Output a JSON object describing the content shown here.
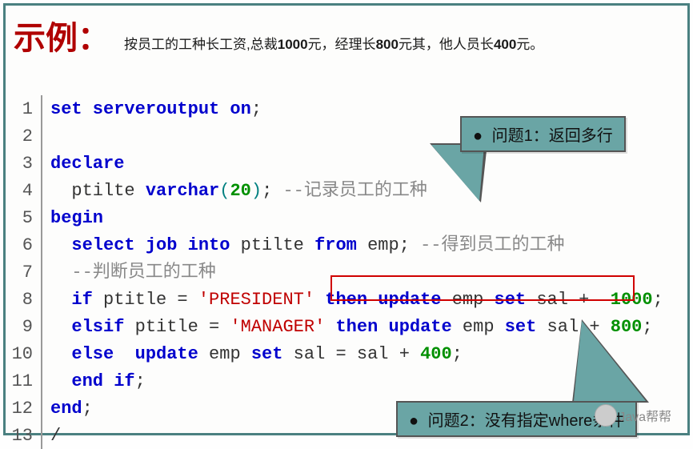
{
  "title": {
    "main": "示例",
    "colon": "：",
    "desc_prefix": "按员工的工种长工资,总裁",
    "n1": "1000",
    "desc_mid1": "元，经理长",
    "n2": "800",
    "desc_mid2": "元其，他人员长",
    "n3": "400",
    "desc_suffix": "元。"
  },
  "code": {
    "lines": [
      {
        "n": "1",
        "segs": [
          {
            "t": "set serveroutput on",
            "c": "kw"
          },
          {
            "t": ";",
            "c": ""
          }
        ]
      },
      {
        "n": "2",
        "segs": []
      },
      {
        "n": "3",
        "segs": [
          {
            "t": "declare",
            "c": "kw"
          }
        ]
      },
      {
        "n": "4",
        "segs": [
          {
            "t": "  ptilte ",
            "c": ""
          },
          {
            "t": "varchar",
            "c": "kw"
          },
          {
            "t": "(",
            "c": "paren"
          },
          {
            "t": "20",
            "c": "num"
          },
          {
            "t": ")",
            "c": "paren"
          },
          {
            "t": "; ",
            "c": ""
          },
          {
            "t": "--记录员工的工种",
            "c": "cmt"
          }
        ]
      },
      {
        "n": "5",
        "segs": [
          {
            "t": "begin",
            "c": "kw"
          }
        ]
      },
      {
        "n": "6",
        "segs": [
          {
            "t": "  ",
            "c": ""
          },
          {
            "t": "select job into",
            "c": "kw"
          },
          {
            "t": " ptilte ",
            "c": ""
          },
          {
            "t": "from",
            "c": "kw"
          },
          {
            "t": " emp; ",
            "c": ""
          },
          {
            "t": "--得到员工的工种",
            "c": "cmt"
          }
        ]
      },
      {
        "n": "7",
        "segs": [
          {
            "t": "  ",
            "c": ""
          },
          {
            "t": "--判断员工的工种",
            "c": "cmt"
          }
        ]
      },
      {
        "n": "8",
        "segs": [
          {
            "t": "  ",
            "c": ""
          },
          {
            "t": "if",
            "c": "kw"
          },
          {
            "t": " ptitle = ",
            "c": ""
          },
          {
            "t": "'PRESIDENT'",
            "c": "str"
          },
          {
            "t": " ",
            "c": ""
          },
          {
            "t": "then",
            "c": "kw"
          },
          {
            "t": " ",
            "c": ""
          },
          {
            "t": "update",
            "c": "kw"
          },
          {
            "t": " emp ",
            "c": ""
          },
          {
            "t": "set",
            "c": "kw"
          },
          {
            "t": " sal +  ",
            "c": ""
          },
          {
            "t": "1000",
            "c": "num"
          },
          {
            "t": ";",
            "c": ""
          }
        ]
      },
      {
        "n": "9",
        "segs": [
          {
            "t": "  ",
            "c": ""
          },
          {
            "t": "elsif",
            "c": "kw"
          },
          {
            "t": " ptitle = ",
            "c": ""
          },
          {
            "t": "'MANAGER'",
            "c": "str"
          },
          {
            "t": " ",
            "c": ""
          },
          {
            "t": "then update",
            "c": "kw"
          },
          {
            "t": " emp ",
            "c": ""
          },
          {
            "t": "set",
            "c": "kw"
          },
          {
            "t": " sal + ",
            "c": ""
          },
          {
            "t": "800",
            "c": "num"
          },
          {
            "t": ";",
            "c": ""
          }
        ]
      },
      {
        "n": "10",
        "segs": [
          {
            "t": "  ",
            "c": ""
          },
          {
            "t": "else",
            "c": "kw"
          },
          {
            "t": "  ",
            "c": ""
          },
          {
            "t": "update",
            "c": "kw"
          },
          {
            "t": " emp ",
            "c": ""
          },
          {
            "t": "set",
            "c": "kw"
          },
          {
            "t": " sal = sal + ",
            "c": ""
          },
          {
            "t": "400",
            "c": "num"
          },
          {
            "t": ";",
            "c": ""
          }
        ]
      },
      {
        "n": "11",
        "segs": [
          {
            "t": "  ",
            "c": ""
          },
          {
            "t": "end if",
            "c": "kw"
          },
          {
            "t": ";",
            "c": ""
          }
        ]
      },
      {
        "n": "12",
        "segs": [
          {
            "t": "end",
            "c": "kw"
          },
          {
            "t": ";",
            "c": ""
          }
        ]
      },
      {
        "n": "13",
        "segs": [
          {
            "t": "/",
            "c": ""
          }
        ]
      }
    ]
  },
  "callouts": {
    "c1": "问题1：返回多行",
    "c2": "问题2：没有指定where条件"
  },
  "watermark": "Java帮帮",
  "bullet": "●"
}
